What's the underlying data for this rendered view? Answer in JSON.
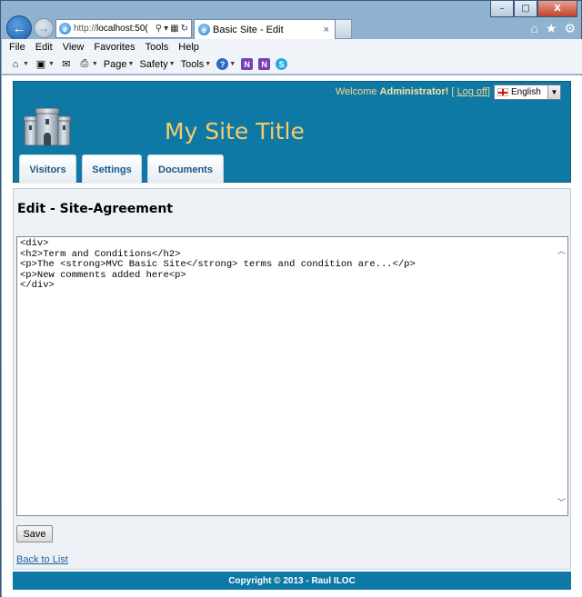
{
  "browser": {
    "address_url_prefix": "http://",
    "address_url_host": "localhost:50(",
    "tab_title": "Basic Site - Edit",
    "tab_close": "×",
    "menu": [
      "File",
      "Edit",
      "View",
      "Favorites",
      "Tools",
      "Help"
    ],
    "toolbar": {
      "page_label": "Page",
      "safety_label": "Safety",
      "tools_label": "Tools"
    },
    "window_controls": {
      "minimize": "–",
      "maximize": "□",
      "close": "X"
    }
  },
  "site": {
    "welcome_prefix": "Welcome ",
    "username": "Administrator!",
    "logoff_open": " [ ",
    "logoff_label": "Log off",
    "logoff_close": "]",
    "language": "English",
    "title": "My Site Title",
    "nav": [
      {
        "label": "Visitors"
      },
      {
        "label": "Settings"
      },
      {
        "label": "Documents"
      }
    ]
  },
  "page": {
    "heading": "Edit - Site-Agreement",
    "editor_content": "<div>\n<h2>Term and Conditions</h2>\n<p>The <strong>MVC Basic Site</strong> terms and condition are...</p>\n<p>New comments added here<p>\n</div>",
    "save_label": "Save",
    "back_label": "Back to List"
  },
  "footer": {
    "copyright": "Copyright © 2013 - Raul ILOC"
  },
  "colors": {
    "header_bg": "#0f79a6",
    "title_color": "#f6cb6a",
    "nav_text": "#16568a"
  }
}
